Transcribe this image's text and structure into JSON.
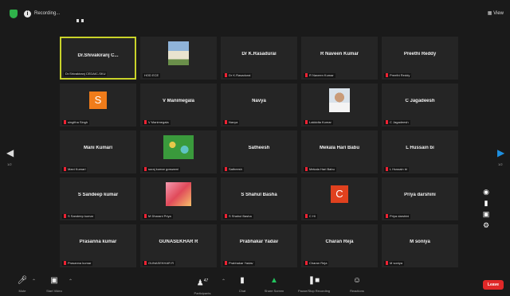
{
  "topbar": {
    "recording_label": "Recording...",
    "view_label": "View"
  },
  "tiles": [
    {
      "name": "Dr.Shivakiranj C...",
      "label": "Dr.Shivakiranj CEDAIC-SKU",
      "active": true,
      "mic": false,
      "kind": "name"
    },
    {
      "name": "",
      "label": "HOD ECE",
      "active": false,
      "mic": false,
      "kind": "photo-building"
    },
    {
      "name": "Dr K.Rasadurai",
      "label": "Dr K.Rasadurai",
      "active": false,
      "mic": true,
      "kind": "name"
    },
    {
      "name": "R Naveen Kumar",
      "label": "R Naveen Kumar",
      "active": false,
      "mic": true,
      "kind": "name"
    },
    {
      "name": "Preethi Reddy",
      "label": "Preethi Reddy",
      "active": false,
      "mic": true,
      "kind": "name"
    },
    {
      "name": "",
      "label": "singitha Singh",
      "active": false,
      "mic": true,
      "kind": "avatar",
      "letter": "S",
      "color": "#f07c1a"
    },
    {
      "name": "V Manimegala",
      "label": "V Manimegala",
      "active": false,
      "mic": true,
      "kind": "name"
    },
    {
      "name": "Navya",
      "label": "Navya",
      "active": false,
      "mic": true,
      "kind": "name"
    },
    {
      "name": "",
      "label": "Lakkidta Kumar",
      "active": false,
      "mic": true,
      "kind": "photo-person"
    },
    {
      "name": "C Jagadeesh",
      "label": "C Jagadeesh",
      "active": false,
      "mic": true,
      "kind": "name"
    },
    {
      "name": "Mani Kumari",
      "label": "Mani Kumari",
      "active": false,
      "mic": true,
      "kind": "name"
    },
    {
      "name": "",
      "label": "suraj kumar goswami",
      "active": false,
      "mic": true,
      "kind": "photo-green"
    },
    {
      "name": "Satheesh",
      "label": "Satheesh",
      "active": false,
      "mic": true,
      "kind": "name"
    },
    {
      "name": "Mekala Hari Babu",
      "label": "Mekala Hari Babu",
      "active": false,
      "mic": true,
      "kind": "name"
    },
    {
      "name": "L Hussain bi",
      "label": "L Hussain bi",
      "active": false,
      "mic": true,
      "kind": "name"
    },
    {
      "name": "S Sandeep kumar",
      "label": "S Sandeep kumar",
      "active": false,
      "mic": true,
      "kind": "name"
    },
    {
      "name": "",
      "label": "M Dharani Priya",
      "active": false,
      "mic": true,
      "kind": "photo-pink"
    },
    {
      "name": "S Shahul Basha",
      "label": "S Shahul Basha",
      "active": false,
      "mic": true,
      "kind": "name"
    },
    {
      "name": "",
      "label": "C Hi",
      "active": false,
      "mic": true,
      "kind": "avatar",
      "letter": "C",
      "color": "#e0411e"
    },
    {
      "name": "Priya darshini",
      "label": "Priya darshini",
      "active": false,
      "mic": true,
      "kind": "name"
    },
    {
      "name": "Prasanna kumar",
      "label": "Prasanna kumar",
      "active": false,
      "mic": true,
      "kind": "name"
    },
    {
      "name": "GUNASEKHAR R",
      "label": "GUNASEKHAR R",
      "active": false,
      "mic": true,
      "kind": "name"
    },
    {
      "name": "Prabhakar Yadav",
      "label": "Prabhakar Yadav",
      "active": false,
      "mic": true,
      "kind": "name"
    },
    {
      "name": "Charan Reja",
      "label": "Charan Reja",
      "active": false,
      "mic": true,
      "kind": "name"
    },
    {
      "name": "M soniya",
      "label": "M soniya",
      "active": false,
      "mic": true,
      "kind": "name"
    }
  ],
  "pagination": {
    "left_page": "1/2",
    "right_page": "1/2"
  },
  "toolbar": {
    "mute": "Mute",
    "start_video": "Start Video",
    "participants": "Participants",
    "participants_count": "47",
    "chat": "Chat",
    "share_screen": "Share Screen",
    "pause_stop_recording": "Pause/Stop Recording",
    "reactions": "Reactions",
    "leave": "Leave"
  },
  "colors": {
    "active_border": "#c9d32a",
    "share_green": "#22c55e",
    "leave_red": "#e02828",
    "right_arrow": "#1e8fe0"
  }
}
